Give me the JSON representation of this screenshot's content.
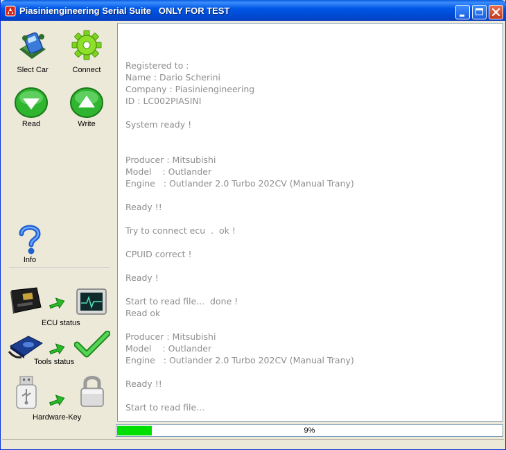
{
  "window": {
    "title": "Piasiniengineering Serial Suite   ONLY FOR TEST"
  },
  "toolbar": {
    "select_car": "Slect Car",
    "connect": "Connect",
    "read": "Read",
    "write": "Write",
    "info": "Info"
  },
  "status": {
    "ecu": "ECU status",
    "tools": "Tools status",
    "hardware_key": "Hardware-Key"
  },
  "log": [
    "Registered to :",
    "Name : Dario Scherini",
    "Company : Piasiniengineering",
    "ID : LC002PIASINI",
    "System ready !",
    "Producer : Mitsubishi",
    "Model    : Outlander",
    "Engine   : Outlander 2.0 Turbo 202CV (Manual Trany)",
    "Ready !!",
    "Try to connect ecu  .  ok !",
    "CPUID correct !",
    "Ready !",
    "Start to read file...  done !",
    "Read ok",
    "Producer : Mitsubishi",
    "Model    : Outlander",
    "Engine   : Outlander 2.0 Turbo 202CV (Manual Trany)",
    "Ready !!",
    "Start to read file..."
  ],
  "progress": {
    "value": 9,
    "label": "9%"
  },
  "colors": {
    "progress_fill": "#00e000",
    "log_text": "#8e8e8e",
    "titlebar": "#0058e6"
  }
}
